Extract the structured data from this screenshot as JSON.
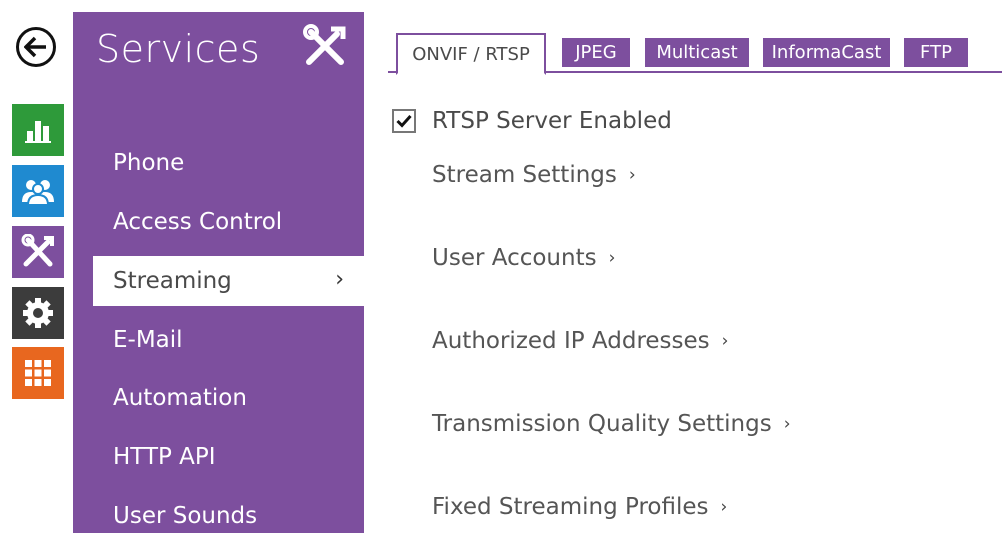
{
  "rail": {
    "back_icon": "back-arrow-icon",
    "tiles": [
      {
        "name": "status",
        "icon": "bar-chart-icon",
        "color": "#2e9a3a"
      },
      {
        "name": "directory",
        "icon": "users-icon",
        "color": "#1f8ad0"
      },
      {
        "name": "services",
        "icon": "tools-icon",
        "color": "#7d4f9e"
      },
      {
        "name": "system",
        "icon": "gear-icon",
        "color": "#3c3c3c"
      },
      {
        "name": "hardware",
        "icon": "grid-icon",
        "color": "#e8671f"
      }
    ]
  },
  "menu": {
    "title": "Services",
    "title_icon": "tools-icon",
    "items": [
      {
        "label": "Phone"
      },
      {
        "label": "Access Control"
      },
      {
        "label": "Streaming",
        "active": true,
        "chevron": "›"
      },
      {
        "label": "E-Mail"
      },
      {
        "label": "Automation"
      },
      {
        "label": "HTTP API"
      },
      {
        "label": "User Sounds"
      }
    ]
  },
  "tabs": [
    {
      "label": "ONVIF / RTSP",
      "active": true
    },
    {
      "label": "JPEG"
    },
    {
      "label": "Multicast"
    },
    {
      "label": "InformaCast"
    },
    {
      "label": "FTP"
    }
  ],
  "content": {
    "rtsp_checkbox": {
      "label": "RTSP Server Enabled",
      "checked": true
    },
    "links": [
      {
        "label": "Stream Settings",
        "chevron": "›"
      },
      {
        "label": "User Accounts",
        "chevron": "›"
      },
      {
        "label": "Authorized IP Addresses",
        "chevron": "›"
      },
      {
        "label": "Transmission Quality Settings",
        "chevron": "›"
      },
      {
        "label": "Fixed Streaming Profiles",
        "chevron": "›"
      }
    ]
  },
  "colors": {
    "purple": "#7d4f9e",
    "text": "#4a4a4a"
  }
}
